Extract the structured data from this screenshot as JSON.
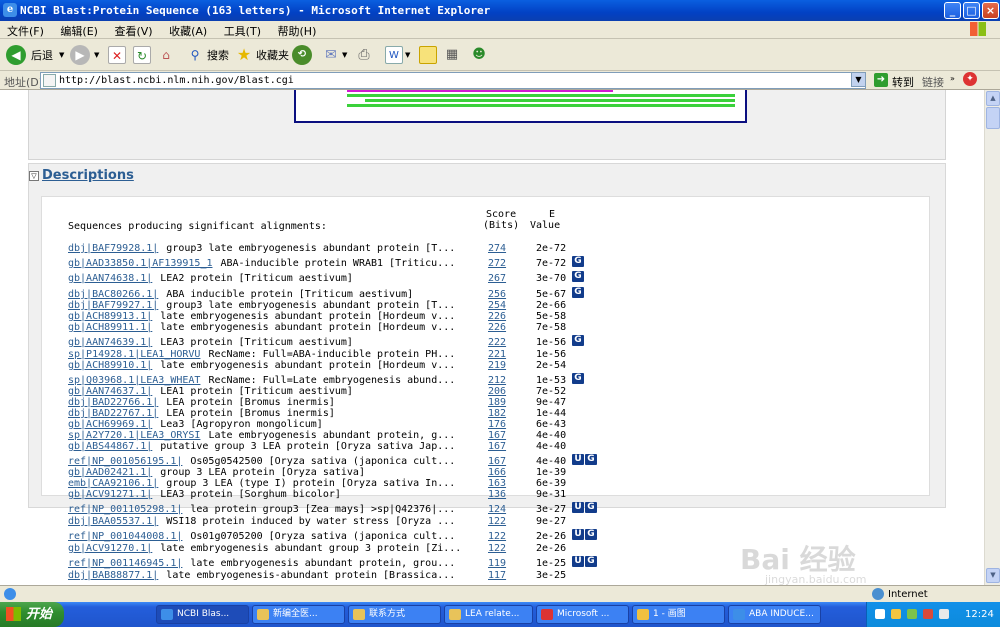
{
  "window": {
    "title": "NCBI Blast:Protein Sequence (163 letters) - Microsoft Internet Explorer"
  },
  "menu": [
    "文件(F)",
    "编辑(E)",
    "查看(V)",
    "收藏(A)",
    "工具(T)",
    "帮助(H)"
  ],
  "toolbar": {
    "back": "后退",
    "search": "搜索",
    "favorites": "收藏夹"
  },
  "address": {
    "label": "地址(D)",
    "url": "http://blast.ncbi.nlm.nih.gov/Blast.cgi",
    "go": "转到",
    "links": "链接"
  },
  "descriptions": {
    "title": "Descriptions",
    "header_line1": "Sequences producing significant alignments:",
    "score_h1": "Score",
    "score_h2": "(Bits)",
    "e_h1": "E",
    "e_h2": "Value",
    "rows": [
      {
        "id": "dbj|BAF79928.1|",
        "desc": "group3 late embryogenesis abundant protein [T...",
        "score": "274",
        "e": "2e-72",
        "g": false,
        "u": false
      },
      {
        "id": "gb|AAD33850.1|AF139915_1",
        "desc": "ABA-inducible protein WRAB1 [Triticu...",
        "score": "272",
        "e": "7e-72",
        "g": true,
        "u": false
      },
      {
        "id": "gb|AAN74638.1|",
        "desc": "LEA2 protein [Triticum aestivum]",
        "score": "267",
        "e": "3e-70",
        "g": true,
        "u": false
      },
      {
        "id": "dbj|BAC80266.1|",
        "desc": "ABA inducible protein [Triticum aestivum]",
        "score": "256",
        "e": "5e-67",
        "g": true,
        "u": false
      },
      {
        "id": "dbj|BAF79927.1|",
        "desc": "group3 late embryogenesis abundant protein [T...",
        "score": "254",
        "e": "2e-66",
        "g": false,
        "u": false
      },
      {
        "id": "gb|ACH89913.1|",
        "desc": "late embryogenesis abundant protein [Hordeum v...",
        "score": "226",
        "e": "5e-58",
        "g": false,
        "u": false
      },
      {
        "id": "gb|ACH89911.1|",
        "desc": "late embryogenesis abundant protein [Hordeum v...",
        "score": "226",
        "e": "7e-58",
        "g": false,
        "u": false
      },
      {
        "id": "gb|AAN74639.1|",
        "desc": "LEA3 protein [Triticum aestivum]",
        "score": "222",
        "e": "1e-56",
        "g": true,
        "u": false
      },
      {
        "id": "sp|P14928.1|LEA1_HORVU",
        "desc": "RecName: Full=ABA-inducible protein PH...",
        "score": "221",
        "e": "1e-56",
        "g": false,
        "u": false
      },
      {
        "id": "gb|ACH89910.1|",
        "desc": "late embryogenesis abundant protein [Hordeum v...",
        "score": "219",
        "e": "2e-54",
        "g": false,
        "u": false
      },
      {
        "id": "sp|Q03968.1|LEA3_WHEAT",
        "desc": "RecName: Full=Late embryogenesis abund...",
        "score": "212",
        "e": "1e-53",
        "g": true,
        "u": false
      },
      {
        "id": "gb|AAN74637.1|",
        "desc": "LEA1 protein [Triticum aestivum]",
        "score": "206",
        "e": "7e-52",
        "g": false,
        "u": false
      },
      {
        "id": "dbj|BAD22766.1|",
        "desc": "LEA protein [Bromus inermis]",
        "score": "189",
        "e": "9e-47",
        "g": false,
        "u": false
      },
      {
        "id": "dbj|BAD22767.1|",
        "desc": "LEA protein [Bromus inermis]",
        "score": "182",
        "e": "1e-44",
        "g": false,
        "u": false
      },
      {
        "id": "gb|ACH69969.1|",
        "desc": "Lea3 [Agropyron mongolicum]",
        "score": "176",
        "e": "6e-43",
        "g": false,
        "u": false
      },
      {
        "id": "sp|A2Y720.1|LEA3_ORYSI",
        "desc": "Late embryogenesis abundant protein, g...",
        "score": "167",
        "e": "4e-40",
        "g": false,
        "u": false
      },
      {
        "id": "gb|ABS44867.1|",
        "desc": "putative group 3 LEA protein [Oryza sativa Jap...",
        "score": "167",
        "e": "4e-40",
        "g": false,
        "u": false
      },
      {
        "id": "ref|NP_001056195.1|",
        "desc": "Os05g0542500 [Oryza sativa (japonica cult...",
        "score": "167",
        "e": "4e-40",
        "g": true,
        "u": true
      },
      {
        "id": "gb|AAD02421.1|",
        "desc": "group 3 LEA protein [Oryza sativa]",
        "score": "166",
        "e": "1e-39",
        "g": false,
        "u": false
      },
      {
        "id": "emb|CAA92106.1|",
        "desc": "group 3 LEA (type I) protein [Oryza sativa In...",
        "score": "163",
        "e": "6e-39",
        "g": false,
        "u": false
      },
      {
        "id": "gb|ACV91271.1|",
        "desc": "LEA3 protein [Sorghum bicolor]",
        "score": "136",
        "e": "9e-31",
        "g": false,
        "u": false
      },
      {
        "id": "ref|NP_001105298.1|",
        "desc": "lea protein group3 [Zea mays] >sp|Q42376|...",
        "score": "124",
        "e": "3e-27",
        "g": true,
        "u": true
      },
      {
        "id": "dbj|BAA05537.1|",
        "desc": "WSI18 protein induced by water stress [Oryza ...",
        "score": "122",
        "e": "9e-27",
        "g": false,
        "u": false
      },
      {
        "id": "ref|NP_001044008.1|",
        "desc": "Os01g0705200 [Oryza sativa (japonica cult...",
        "score": "122",
        "e": "2e-26",
        "g": true,
        "u": true
      },
      {
        "id": "gb|ACV91270.1|",
        "desc": "late embryogenesis abundant group 3 protein [Zi...",
        "score": "122",
        "e": "2e-26",
        "g": false,
        "u": false
      },
      {
        "id": "ref|NP_001146945.1|",
        "desc": "late embryogenesis abundant protein, grou...",
        "score": "119",
        "e": "1e-25",
        "g": true,
        "u": true
      },
      {
        "id": "dbj|BAB88877.1|",
        "desc": "late embryogenesis-abundant protein [Brassica...",
        "score": "117",
        "e": "3e-25",
        "g": false,
        "u": false
      }
    ]
  },
  "status": {
    "zone": "Internet"
  },
  "taskbar": {
    "start": "开始",
    "tasks": [
      "NCBI Blas...",
      "新编全医...",
      "联系方式",
      "LEA relate...",
      "Microsoft ...",
      "1 - 画图",
      "ABA INDUCE..."
    ],
    "clock": "12:24"
  },
  "watermark": {
    "brand": "Bai 经验",
    "url": "jingyan.baidu.com"
  },
  "colors": {
    "titlebar": "#0241c4",
    "link": "#2c5e93",
    "g_icon": "#123c8b",
    "graph_border": "#0b0f80"
  }
}
